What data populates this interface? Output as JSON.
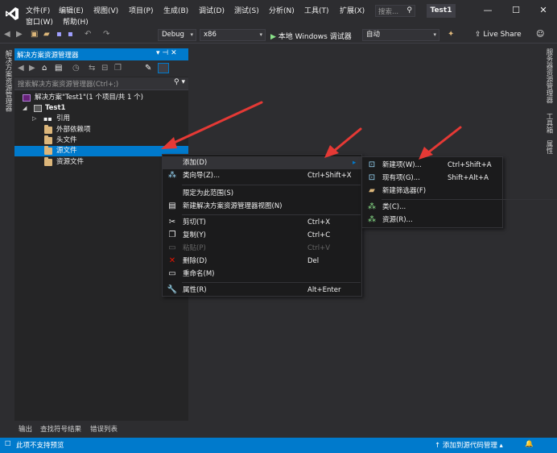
{
  "titlebar": {
    "menu_row1": [
      "文件(F)",
      "编辑(E)",
      "视图(V)",
      "项目(P)",
      "生成(B)",
      "调试(D)",
      "测试(S)",
      "分析(N)",
      "工具(T)",
      "扩展(X)"
    ],
    "menu_row2": [
      "窗口(W)",
      "帮助(H)"
    ],
    "search_placeholder": "搜索...",
    "project_name": "Test1",
    "min": "—",
    "max": "☐",
    "close": "✕"
  },
  "toolbar": {
    "config": "Debug",
    "platform": "x86",
    "run_label": "本地 Windows 调试器",
    "run_mode": "自动",
    "live_share": "Live Share"
  },
  "left_tab": {
    "label": "解决方案资源管理器"
  },
  "right_tabs": [
    "服务器资源管理器",
    "工具箱",
    "属性"
  ],
  "solution_explorer": {
    "title": "解决方案资源管理器",
    "pin": "▾ ⊣ ✕",
    "search_placeholder": "搜索解决方案资源管理器(Ctrl+;)",
    "tree": [
      {
        "label": "解决方案\"Test1\"(1 个项目/共 1 个)",
        "indent": 0
      },
      {
        "label": "Test1",
        "indent": 1
      },
      {
        "label": "引用",
        "indent": 2
      },
      {
        "label": "外部依赖项",
        "indent": 2
      },
      {
        "label": "头文件",
        "indent": 2
      },
      {
        "label": "源文件",
        "indent": 2,
        "selected": true
      },
      {
        "label": "资源文件",
        "indent": 2
      }
    ]
  },
  "context_menu": {
    "items": [
      {
        "label": "添加(D)",
        "shortcut": "",
        "icon": "",
        "submenu": true
      },
      {
        "label": "类向导(Z)...",
        "shortcut": "Ctrl+Shift+X",
        "icon": "class-wizard-icon"
      },
      {
        "label": "限定为此范围(S)",
        "shortcut": "",
        "icon": ""
      },
      {
        "label": "新建解决方案资源管理器视图(N)",
        "shortcut": "",
        "icon": "new-view-icon"
      },
      {
        "label": "剪切(T)",
        "shortcut": "Ctrl+X",
        "icon": "scissors-icon"
      },
      {
        "label": "复制(Y)",
        "shortcut": "Ctrl+C",
        "icon": "copy-icon"
      },
      {
        "label": "粘贴(P)",
        "shortcut": "Ctrl+V",
        "icon": "paste-icon",
        "disabled": true
      },
      {
        "label": "删除(D)",
        "shortcut": "Del",
        "icon": "delete-icon"
      },
      {
        "label": "重命名(M)",
        "shortcut": "",
        "icon": "rename-icon"
      },
      {
        "label": "属性(R)",
        "shortcut": "Alt+Enter",
        "icon": "wrench-icon"
      }
    ]
  },
  "sub_menu": {
    "items": [
      {
        "label": "新建项(W)...",
        "shortcut": "Ctrl+Shift+A",
        "icon": "new-item-icon"
      },
      {
        "label": "现有项(G)...",
        "shortcut": "Shift+Alt+A",
        "icon": "existing-item-icon"
      },
      {
        "label": "新建筛选器(F)",
        "shortcut": "",
        "icon": "new-filter-icon"
      },
      {
        "label": "类(C)...",
        "shortcut": "",
        "icon": "class-icon"
      },
      {
        "label": "资源(R)...",
        "shortcut": "",
        "icon": "resource-icon"
      }
    ]
  },
  "bottom_tabs": [
    "输出",
    "查找符号结果",
    "错误列表"
  ],
  "statusbar": {
    "left": "此项不支持预览",
    "right": "添加到源代码管理"
  },
  "colors": {
    "accent": "#007acc",
    "arrow": "#e53935"
  }
}
